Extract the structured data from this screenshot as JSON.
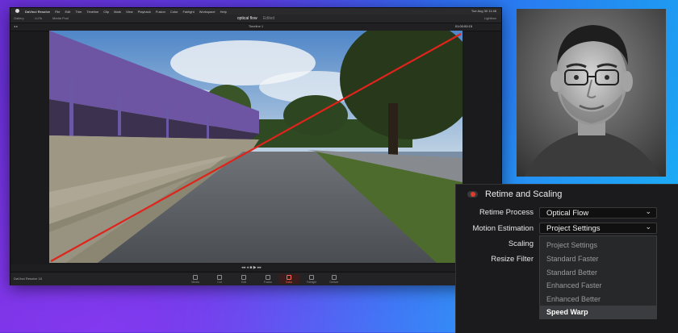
{
  "app": {
    "name": "DaVinci Resolve",
    "menu": [
      "DaVinci Resolve",
      "File",
      "Edit",
      "Trim",
      "Timeline",
      "Clip",
      "Mark",
      "View",
      "Playback",
      "Fusion",
      "Color",
      "Fairlight",
      "Workspace",
      "Help"
    ],
    "clock": "Tue Aug 30  11:46",
    "project_title": "optical flow",
    "edited_label": "Edited",
    "timeline_name": "Timeline 1",
    "timecode": "01:00:00:15",
    "toolbar_left": [
      "Gallery",
      "LUTs",
      "Media Pool"
    ],
    "toolbar_right": [
      "Lightbox"
    ],
    "page_tabs": [
      "Media",
      "Cut",
      "Edit",
      "Fusion",
      "Color",
      "Fairlight",
      "Deliver"
    ],
    "active_page": "Color",
    "brand": "DaVinci Resolve 18"
  },
  "panel": {
    "title": "Retime and Scaling",
    "retime_process_label": "Retime Process",
    "retime_process_value": "Optical Flow",
    "motion_estimation_label": "Motion Estimation",
    "motion_estimation_value": "Project Settings",
    "scaling_label": "Scaling",
    "resize_filter_label": "Resize Filter",
    "motion_options": [
      "Project Settings",
      "Standard Faster",
      "Standard Better",
      "Enhanced Faster",
      "Enhanced Better",
      "Speed Warp"
    ],
    "selected_option": "Speed Warp",
    "accent": "#e23b2e"
  },
  "annotation": {
    "line_color": "#e0231b"
  },
  "icons": [
    "apple-icon",
    "chevron-down-icon",
    "toggle-switch-icon",
    "media-page-icon",
    "cut-page-icon",
    "edit-page-icon",
    "fusion-page-icon",
    "color-page-icon",
    "fairlight-page-icon",
    "deliver-page-icon",
    "play-icon"
  ]
}
